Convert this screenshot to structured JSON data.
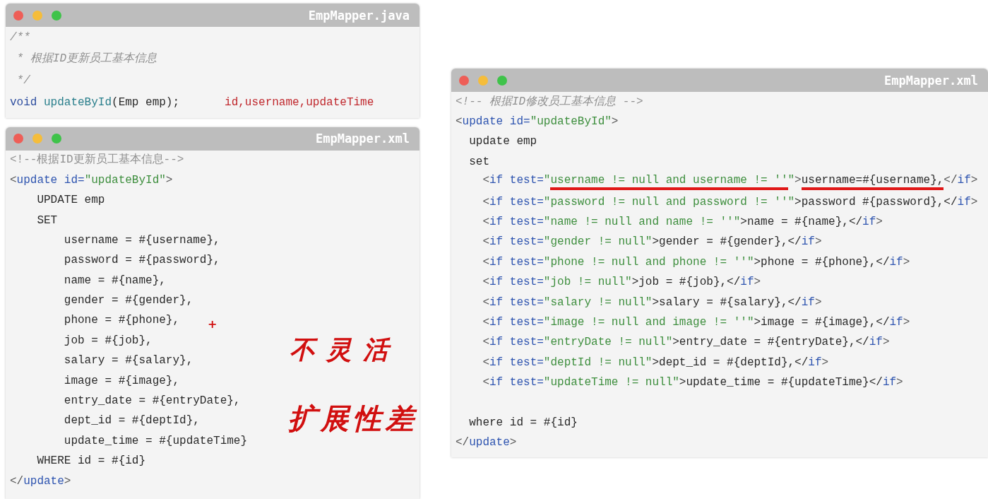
{
  "windows": [
    {
      "title": "EmpMapper.java",
      "lines": [
        {
          "tokens": [
            {
              "text": "/**",
              "kind": "comment"
            }
          ]
        },
        {
          "tokens": [
            {
              "text": " * 根据ID更新员工基本信息",
              "kind": "comment"
            }
          ]
        },
        {
          "tokens": [
            {
              "text": " */",
              "kind": "comment"
            }
          ]
        },
        {
          "tokens": [
            {
              "text": "void",
              "kind": "keyword"
            },
            {
              "text": " updateById",
              "kind": "method"
            },
            {
              "text": "(Emp emp);",
              "kind": "text"
            }
          ],
          "note": "id,username,updateTime"
        }
      ]
    },
    {
      "title": "EmpMapper.xml",
      "lines": [
        {
          "tokens": [
            {
              "text": "<!--根据ID更新员工基本信息-->",
              "kind": "plain-comment"
            }
          ]
        },
        {
          "tokens": [
            {
              "text": "<",
              "kind": "punct"
            },
            {
              "text": "update",
              "kind": "tag"
            },
            {
              "text": " id=",
              "kind": "attr"
            },
            {
              "text": "\"updateById\"",
              "kind": "string"
            },
            {
              "text": ">",
              "kind": "punct"
            }
          ]
        },
        {
          "tokens": [
            {
              "text": "    UPDATE emp",
              "kind": "text"
            }
          ]
        },
        {
          "tokens": [
            {
              "text": "    SET",
              "kind": "text"
            }
          ]
        },
        {
          "tokens": [
            {
              "text": "        username = #{username},",
              "kind": "text"
            }
          ]
        },
        {
          "tokens": [
            {
              "text": "        password = #{password},",
              "kind": "text"
            }
          ]
        },
        {
          "tokens": [
            {
              "text": "        name = #{name},",
              "kind": "text"
            }
          ]
        },
        {
          "tokens": [
            {
              "text": "        gender = #{gender},",
              "kind": "text"
            }
          ]
        },
        {
          "tokens": [
            {
              "text": "        phone = #{phone},",
              "kind": "text"
            }
          ]
        },
        {
          "tokens": [
            {
              "text": "        job = #{job},",
              "kind": "text"
            }
          ]
        },
        {
          "tokens": [
            {
              "text": "        salary = #{salary},",
              "kind": "text"
            }
          ]
        },
        {
          "tokens": [
            {
              "text": "        image = #{image},",
              "kind": "text"
            }
          ]
        },
        {
          "tokens": [
            {
              "text": "        entry_date = #{entryDate},",
              "kind": "text"
            }
          ]
        },
        {
          "tokens": [
            {
              "text": "        dept_id = #{deptId},",
              "kind": "text"
            }
          ]
        },
        {
          "tokens": [
            {
              "text": "        update_time = #{updateTime}",
              "kind": "text"
            }
          ]
        },
        {
          "tokens": [
            {
              "text": "    WHERE id = #{id}",
              "kind": "text"
            }
          ]
        },
        {
          "tokens": [
            {
              "text": "</",
              "kind": "punct"
            },
            {
              "text": "update",
              "kind": "tag"
            },
            {
              "text": ">",
              "kind": "punct"
            }
          ]
        }
      ],
      "overlays": [
        {
          "text": "+",
          "kind": "cursor-mark"
        },
        {
          "text": "不灵活",
          "kind": "handwriting"
        },
        {
          "text": "扩展性差",
          "kind": "handwriting"
        }
      ]
    },
    {
      "title": "EmpMapper.xml",
      "lines": [
        {
          "tokens": [
            {
              "text": "<!-- 根据ID修改员工基本信息 -->",
              "kind": "comment"
            }
          ]
        },
        {
          "tokens": [
            {
              "text": "<",
              "kind": "punct"
            },
            {
              "text": "update",
              "kind": "tag"
            },
            {
              "text": " id=",
              "kind": "attr"
            },
            {
              "text": "\"updateById\"",
              "kind": "string"
            },
            {
              "text": ">",
              "kind": "punct"
            }
          ]
        },
        {
          "tokens": [
            {
              "text": "  update emp",
              "kind": "text"
            }
          ]
        },
        {
          "tokens": [
            {
              "text": "  set",
              "kind": "text"
            }
          ]
        },
        {
          "tokens": [
            {
              "text": "    <",
              "kind": "punct"
            },
            {
              "text": "if",
              "kind": "tag"
            },
            {
              "text": " test=",
              "kind": "attr"
            },
            {
              "text": "\"",
              "kind": "string"
            },
            {
              "text": "username != null and username != ''",
              "kind": "string",
              "underlined": true
            },
            {
              "text": "\"",
              "kind": "string"
            },
            {
              "text": ">",
              "kind": "punct"
            },
            {
              "text": "username=#{username},",
              "kind": "text",
              "underlined": true
            },
            {
              "text": "</",
              "kind": "punct"
            },
            {
              "text": "if",
              "kind": "tag"
            },
            {
              "text": ">",
              "kind": "punct"
            }
          ]
        },
        {
          "tokens": [
            {
              "text": "    <",
              "kind": "punct"
            },
            {
              "text": "if",
              "kind": "tag"
            },
            {
              "text": " test=",
              "kind": "attr"
            },
            {
              "text": "\"password != null and password != ''\"",
              "kind": "string"
            },
            {
              "text": ">password #{password},</",
              "kind": "text"
            },
            {
              "text": "if",
              "kind": "tag"
            },
            {
              "text": ">",
              "kind": "punct"
            }
          ]
        },
        {
          "tokens": [
            {
              "text": "    <",
              "kind": "punct"
            },
            {
              "text": "if",
              "kind": "tag"
            },
            {
              "text": " test=",
              "kind": "attr"
            },
            {
              "text": "\"name != null and name != ''\"",
              "kind": "string"
            },
            {
              "text": ">name = #{name},</",
              "kind": "text"
            },
            {
              "text": "if",
              "kind": "tag"
            },
            {
              "text": ">",
              "kind": "punct"
            }
          ]
        },
        {
          "tokens": [
            {
              "text": "    <",
              "kind": "punct"
            },
            {
              "text": "if",
              "kind": "tag"
            },
            {
              "text": " test=",
              "kind": "attr"
            },
            {
              "text": "\"gender != null\"",
              "kind": "string"
            },
            {
              "text": ">gender = #{gender},</",
              "kind": "text"
            },
            {
              "text": "if",
              "kind": "tag"
            },
            {
              "text": ">",
              "kind": "punct"
            }
          ]
        },
        {
          "tokens": [
            {
              "text": "    <",
              "kind": "punct"
            },
            {
              "text": "if",
              "kind": "tag"
            },
            {
              "text": " test=",
              "kind": "attr"
            },
            {
              "text": "\"phone != null and phone != ''\"",
              "kind": "string"
            },
            {
              "text": ">phone = #{phone},</",
              "kind": "text"
            },
            {
              "text": "if",
              "kind": "tag"
            },
            {
              "text": ">",
              "kind": "punct"
            }
          ]
        },
        {
          "tokens": [
            {
              "text": "    <",
              "kind": "punct"
            },
            {
              "text": "if",
              "kind": "tag"
            },
            {
              "text": " test=",
              "kind": "attr"
            },
            {
              "text": "\"job != null\"",
              "kind": "string"
            },
            {
              "text": ">job = #{job},</",
              "kind": "text"
            },
            {
              "text": "if",
              "kind": "tag"
            },
            {
              "text": ">",
              "kind": "punct"
            }
          ]
        },
        {
          "tokens": [
            {
              "text": "    <",
              "kind": "punct"
            },
            {
              "text": "if",
              "kind": "tag"
            },
            {
              "text": " test=",
              "kind": "attr"
            },
            {
              "text": "\"salary != null\"",
              "kind": "string"
            },
            {
              "text": ">salary = #{salary},</",
              "kind": "text"
            },
            {
              "text": "if",
              "kind": "tag"
            },
            {
              "text": ">",
              "kind": "punct"
            }
          ]
        },
        {
          "tokens": [
            {
              "text": "    <",
              "kind": "punct"
            },
            {
              "text": "if",
              "kind": "tag"
            },
            {
              "text": " test=",
              "kind": "attr"
            },
            {
              "text": "\"image != null and image != ''\"",
              "kind": "string"
            },
            {
              "text": ">image = #{image},</",
              "kind": "text"
            },
            {
              "text": "if",
              "kind": "tag"
            },
            {
              "text": ">",
              "kind": "punct"
            }
          ]
        },
        {
          "tokens": [
            {
              "text": "    <",
              "kind": "punct"
            },
            {
              "text": "if",
              "kind": "tag"
            },
            {
              "text": " test=",
              "kind": "attr"
            },
            {
              "text": "\"entryDate != null\"",
              "kind": "string"
            },
            {
              "text": ">entry_date = #{entryDate},</",
              "kind": "text"
            },
            {
              "text": "if",
              "kind": "tag"
            },
            {
              "text": ">",
              "kind": "punct"
            }
          ]
        },
        {
          "tokens": [
            {
              "text": "    <",
              "kind": "punct"
            },
            {
              "text": "if",
              "kind": "tag"
            },
            {
              "text": " test=",
              "kind": "attr"
            },
            {
              "text": "\"deptId != null\"",
              "kind": "string"
            },
            {
              "text": ">dept_id = #{deptId},</",
              "kind": "text"
            },
            {
              "text": "if",
              "kind": "tag"
            },
            {
              "text": ">",
              "kind": "punct"
            }
          ]
        },
        {
          "tokens": [
            {
              "text": "    <",
              "kind": "punct"
            },
            {
              "text": "if",
              "kind": "tag"
            },
            {
              "text": " test=",
              "kind": "attr"
            },
            {
              "text": "\"updateTime != null\"",
              "kind": "string"
            },
            {
              "text": ">update_time = #{updateTime}</",
              "kind": "text"
            },
            {
              "text": "if",
              "kind": "tag"
            },
            {
              "text": ">",
              "kind": "punct"
            }
          ]
        },
        {
          "tokens": [
            {
              "text": "  where id = #{id}",
              "kind": "text"
            }
          ],
          "spaced": true
        },
        {
          "tokens": [
            {
              "text": "</",
              "kind": "punct"
            },
            {
              "text": "update",
              "kind": "tag"
            },
            {
              "text": ">",
              "kind": "punct"
            }
          ]
        }
      ]
    }
  ]
}
